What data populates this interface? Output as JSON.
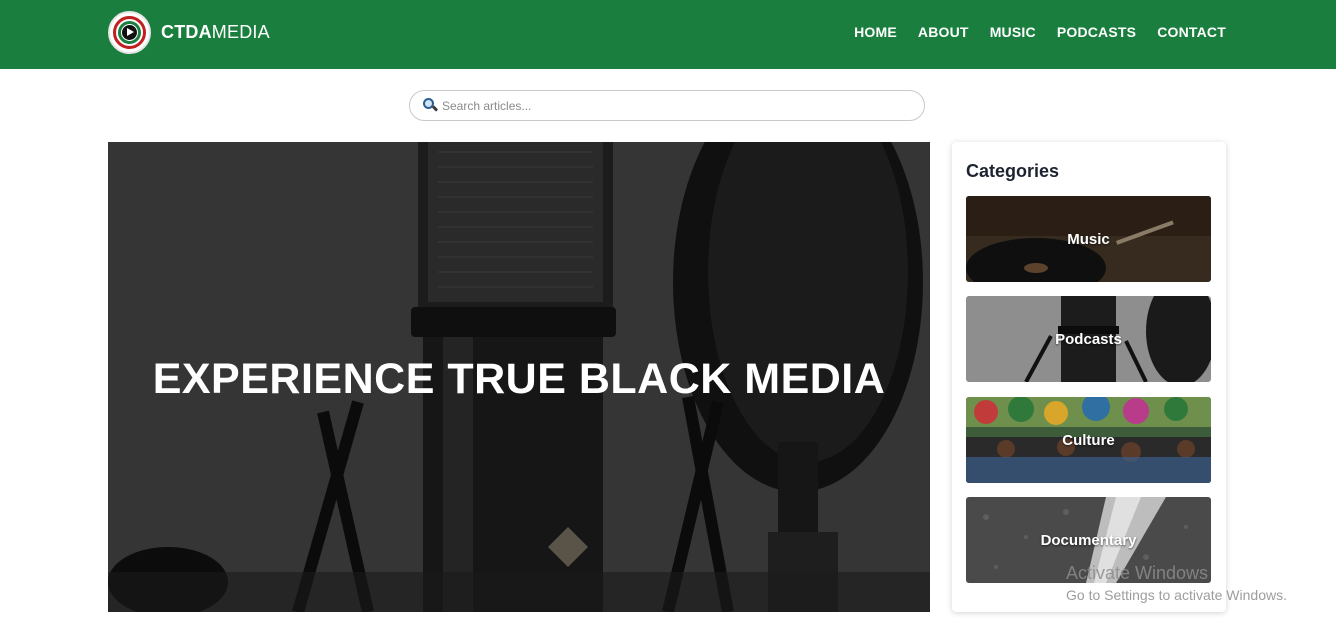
{
  "header": {
    "brand_bold": "CTDA",
    "brand_light": "MEDIA",
    "nav": [
      {
        "label": "HOME"
      },
      {
        "label": "ABOUT"
      },
      {
        "label": "MUSIC"
      },
      {
        "label": "PODCASTS"
      },
      {
        "label": "CONTACT"
      }
    ]
  },
  "search": {
    "placeholder": "Search articles...",
    "icon": "magnifier-icon"
  },
  "hero": {
    "title": "EXPERIENCE TRUE BLACK MEDIA"
  },
  "sidebar": {
    "title": "Categories",
    "categories": [
      {
        "label": "Music"
      },
      {
        "label": "Podcasts"
      },
      {
        "label": "Culture"
      },
      {
        "label": "Documentary"
      }
    ]
  },
  "watermark": {
    "line1": "Activate Windows",
    "line2": "Go to Settings to activate Windows."
  },
  "colors": {
    "header_bg": "#1a7f3e",
    "text_dark": "#1d2430"
  }
}
